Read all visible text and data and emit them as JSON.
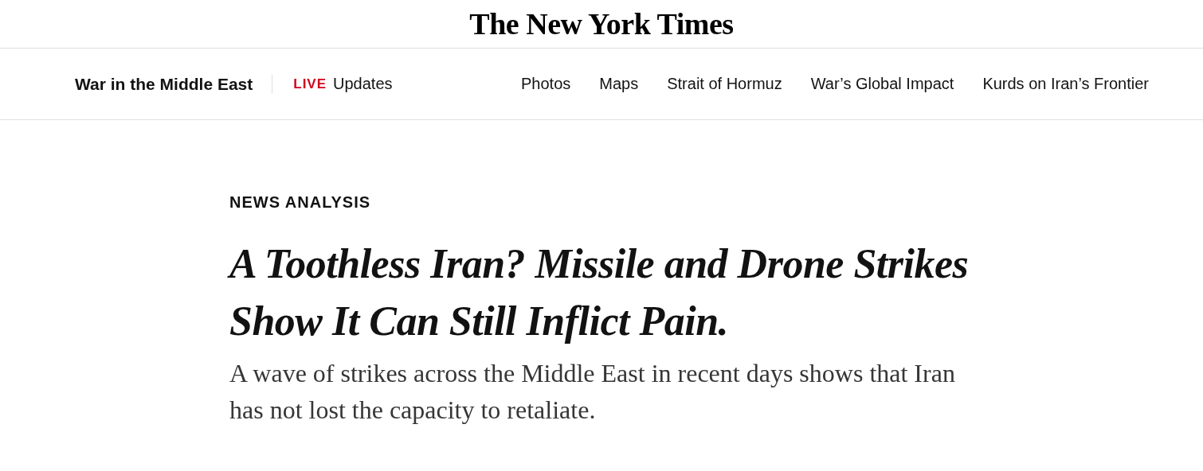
{
  "masthead": {
    "logo": "The New York Times"
  },
  "nav": {
    "section": "War in the Middle East",
    "live": {
      "badge": "LIVE",
      "label": "Updates"
    },
    "links": [
      "Photos",
      "Maps",
      "Strait of Hormuz",
      "War’s Global Impact",
      "Kurds on Iran’s Frontier"
    ]
  },
  "article": {
    "kicker": "NEWS ANALYSIS",
    "headline": "A Toothless Iran? Missile and Drone Strikes Show It Can Still Inflict Pain.",
    "summary": "A wave of strikes across the Middle East in recent days shows that Iran has not lost the capacity to retaliate."
  }
}
